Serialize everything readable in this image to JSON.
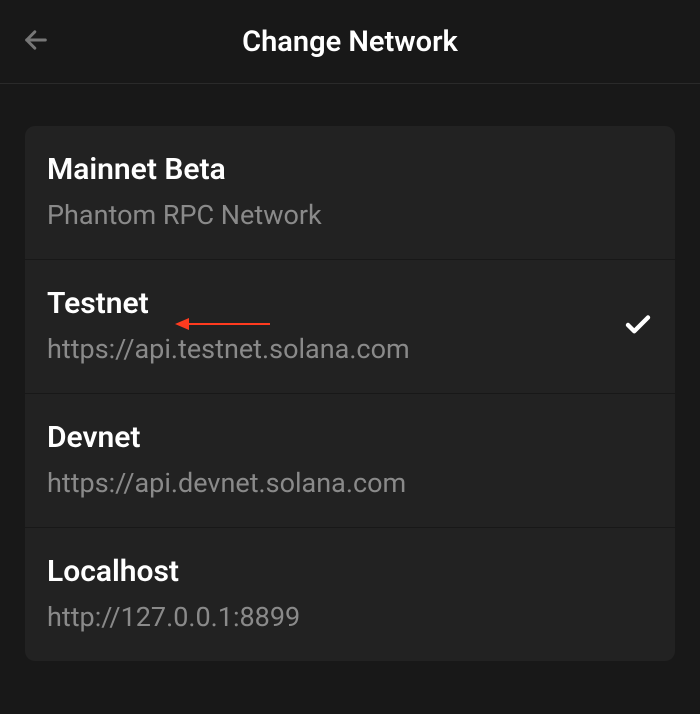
{
  "header": {
    "title": "Change Network"
  },
  "networks": [
    {
      "name": "Mainnet Beta",
      "url": "Phantom RPC Network",
      "selected": false
    },
    {
      "name": "Testnet",
      "url": "https://api.testnet.solana.com",
      "selected": true
    },
    {
      "name": "Devnet",
      "url": "https://api.devnet.solana.com",
      "selected": false
    },
    {
      "name": "Localhost",
      "url": "http://127.0.0.1:8899",
      "selected": false
    }
  ]
}
